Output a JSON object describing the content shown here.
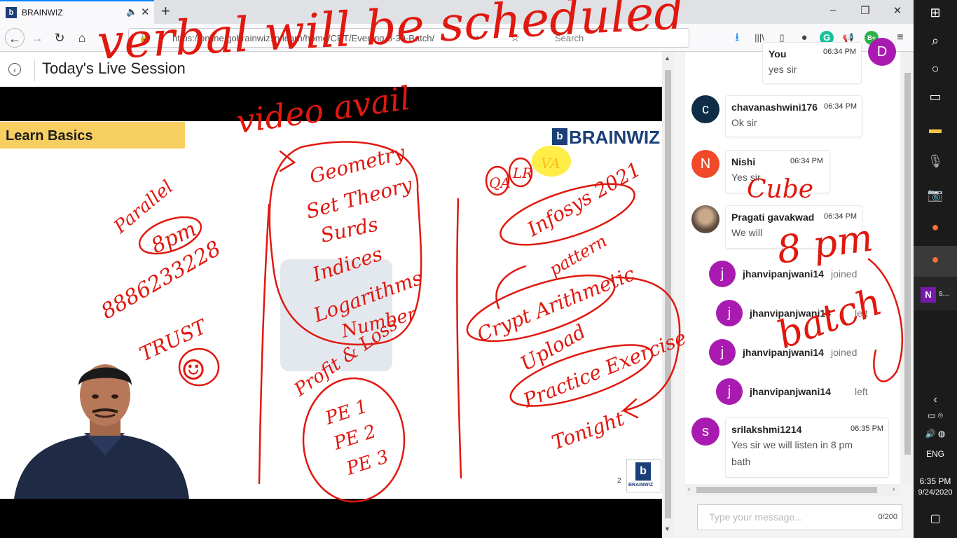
{
  "browser": {
    "tab_title": "BRAINWIZ",
    "favicon_letter": "b",
    "url": "https://online.gobrainwiz.in/learn/home/CRT/Evening-8-30-Batch/",
    "search_placeholder": "Search",
    "window_buttons": [
      "–",
      "❐",
      "✕"
    ]
  },
  "page": {
    "title": "Today's Live Session"
  },
  "slide": {
    "banner": "Learn Basics",
    "logo_text": "BRAINWIZ",
    "logo_mark": "b",
    "small_logo_text": "BRAINWIZ",
    "slide_number": "2",
    "ink": {
      "top_note": "verbal will be scheduled",
      "video_note": "video avail",
      "left": [
        "Parallel",
        "8pm",
        "8886233228",
        "TRUST",
        "☺"
      ],
      "middle": [
        "Geometry",
        "Set Theory",
        "Surds",
        "Indices",
        "Logarithms",
        "Number",
        "Profit & Loss",
        "PE 1",
        "PE 2",
        "PE 3"
      ],
      "right_tags": [
        "QA",
        "LR",
        "VA"
      ],
      "right": [
        "Infosys 2021",
        "pattern",
        "Crypt Arithmetic",
        "Upload",
        "Practice Exercise",
        "Tonight"
      ],
      "chat_overlay": [
        "Cube",
        "8 pm",
        "batch"
      ]
    }
  },
  "chat": {
    "messages": [
      {
        "avatar": "D",
        "name": "You",
        "time": "06:34 PM",
        "text": "yes sir",
        "color": "#a91bb0"
      },
      {
        "avatar": "c",
        "name": "chavanashwini176",
        "time": "06:34 PM",
        "text": "Ok sir",
        "color": "#0f2d47"
      },
      {
        "avatar": "N",
        "name": "Nishi",
        "time": "06:34 PM",
        "text": "Yes sir",
        "color": "#f04a2b"
      },
      {
        "avatar": "",
        "name": "Pragati gavakwad",
        "time": "06:34 PM",
        "text": "We will",
        "color": "#6b5a4e"
      },
      {
        "avatar": "s",
        "name": "srilakshmi1214",
        "time": "06:35 PM",
        "text": "Yes sir we will listen in 8 pm",
        "text2": "bath",
        "color": "#a91bb0"
      }
    ],
    "events": [
      {
        "avatar": "j",
        "user": "jhanvipanjwani14",
        "action": "joined"
      },
      {
        "avatar": "j",
        "user": "jhanvipanjwani14",
        "action": "left"
      },
      {
        "avatar": "j",
        "user": "jhanvipanjwani14",
        "action": "joined"
      },
      {
        "avatar": "j",
        "user": "jhanvipanjwani14",
        "action": "left"
      }
    ],
    "input_placeholder": "Type your message...",
    "char_count": "0/200"
  },
  "taskbar": {
    "onenote_label": "s...",
    "language": "ENG",
    "time": "6:35 PM",
    "date": "9/24/2020"
  }
}
